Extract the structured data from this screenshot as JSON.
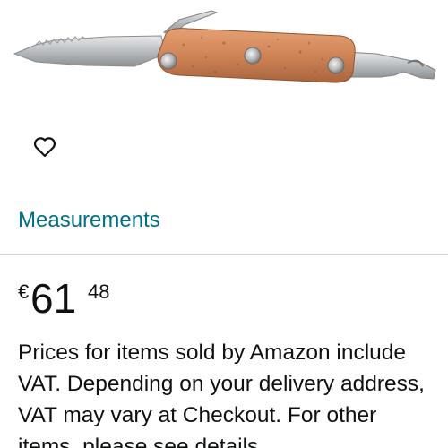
{
  "product": {
    "image_alt": "Pocket knife with cork handle",
    "wishlist_icon": "heart-outline-icon"
  },
  "measurements_link": "Measurements",
  "price": {
    "currency_symbol": "€",
    "whole": "61",
    "fraction": "48"
  },
  "vat_note": "Prices for items sold by Amazon include VAT. Depending on your delivery address, VAT may vary at Checkout. For other items, please see details.",
  "colors": {
    "link": "#007185",
    "text": "#0f1111",
    "divider": "#d5d9d9"
  }
}
